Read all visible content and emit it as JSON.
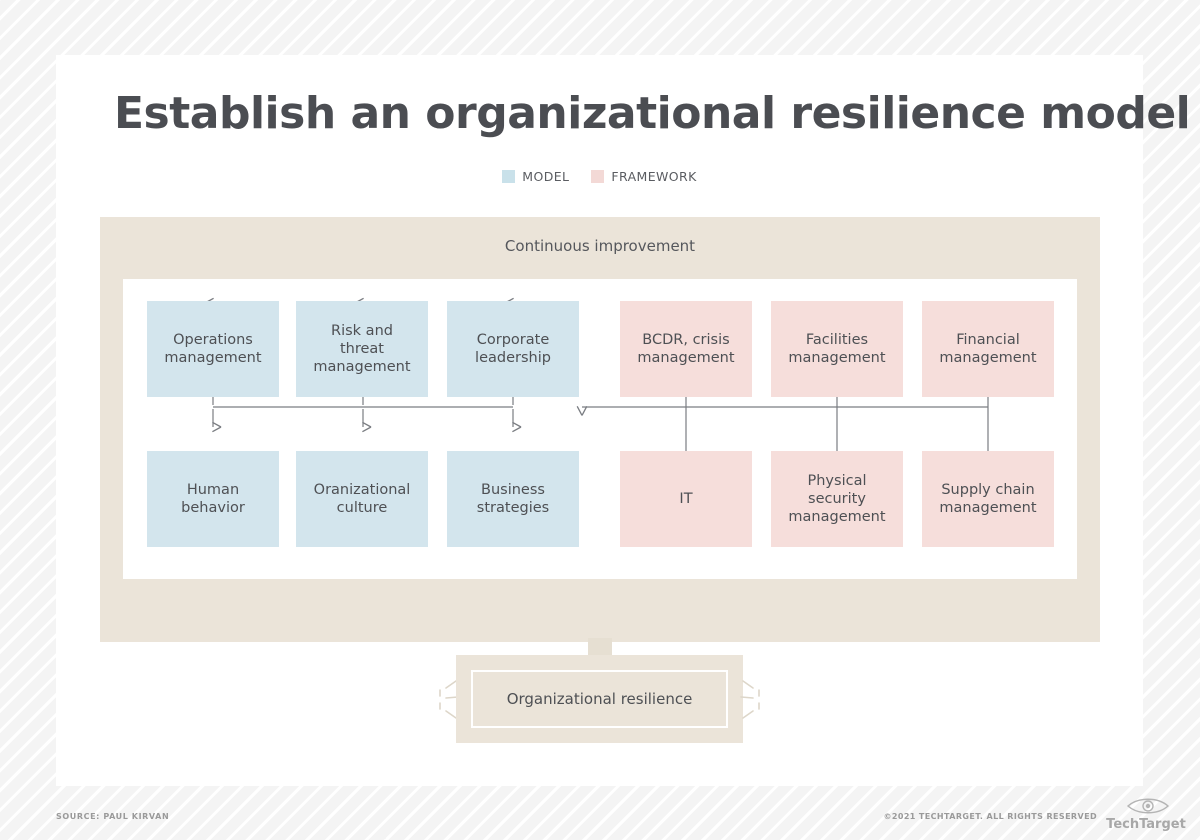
{
  "header": {
    "title": "Establish an organizational resilience model"
  },
  "legend": {
    "items": [
      {
        "label": "MODEL",
        "color": "#c9e1ea",
        "icon": "legend-swatch-icon"
      },
      {
        "label": "FRAMEWORK",
        "color": "#f3d9d6",
        "icon": "legend-swatch-icon"
      }
    ]
  },
  "panel": {
    "caption": "Continuous improvement",
    "outer_color": "#ebe4d9",
    "inner_color": "#ffffff"
  },
  "diagram": {
    "model_color": "#d3e5ed",
    "framework_color": "#f6dedb",
    "connector_color": "#7a7d82",
    "model_boxes_top": [
      "Operations\nmanagement",
      "Risk and\nthreat\nmanagement",
      "Corporate\nleadership"
    ],
    "model_boxes_bottom": [
      "Human\nbehavior",
      "Oranizational\nculture",
      "Business\nstrategies"
    ],
    "framework_boxes_top": [
      "BCDR, crisis\nmanagement",
      "Facilities\nmanagement",
      "Financial\nmanagement"
    ],
    "framework_boxes_bottom": [
      "IT",
      "Physical\nsecurity\nmanagement",
      "Supply chain\nmanagement"
    ]
  },
  "result": {
    "label": "Organizational resilience"
  },
  "footer": {
    "source": "SOURCE: PAUL KIRVAN",
    "copyright": "©2021 TECHTARGET. ALL RIGHTS RESERVED",
    "logo_text": "TechTarget"
  }
}
